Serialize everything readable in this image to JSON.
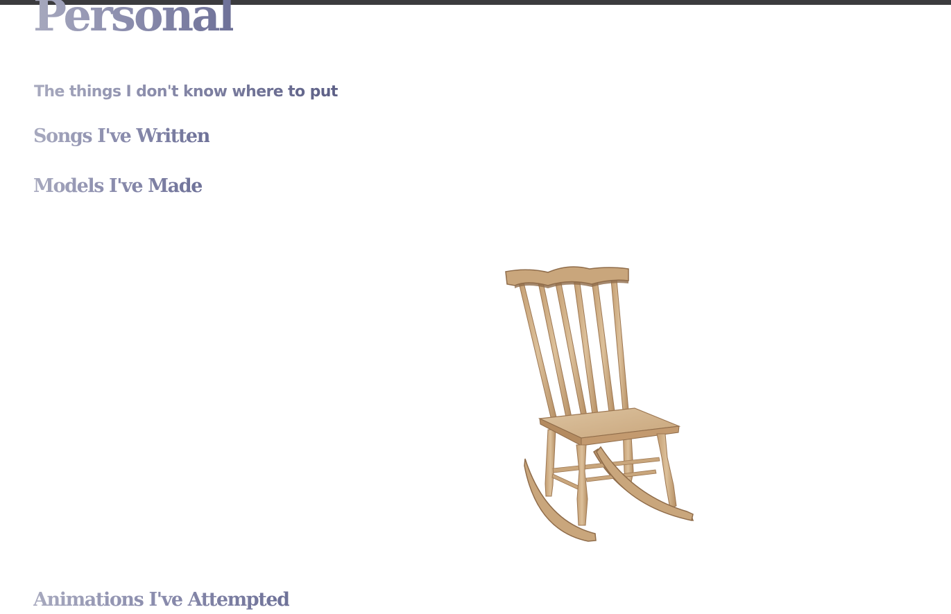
{
  "page": {
    "title": "Personal",
    "subtitle": "The things I don't know where to put"
  },
  "sections": [
    {
      "label": "Songs I've Written"
    },
    {
      "label": "Models I've Made"
    },
    {
      "label": "Animations I've Attempted"
    }
  ],
  "model": {
    "subject": "rocking-chair",
    "colors": {
      "wood_light": "#d8b98f",
      "wood_mid": "#c7a176",
      "wood_dark": "#9c7651"
    }
  },
  "colors": {
    "topbar": "#3b3b3e",
    "heading_gradient_start": "#a7a9be",
    "heading_gradient_end": "#6e7198"
  }
}
